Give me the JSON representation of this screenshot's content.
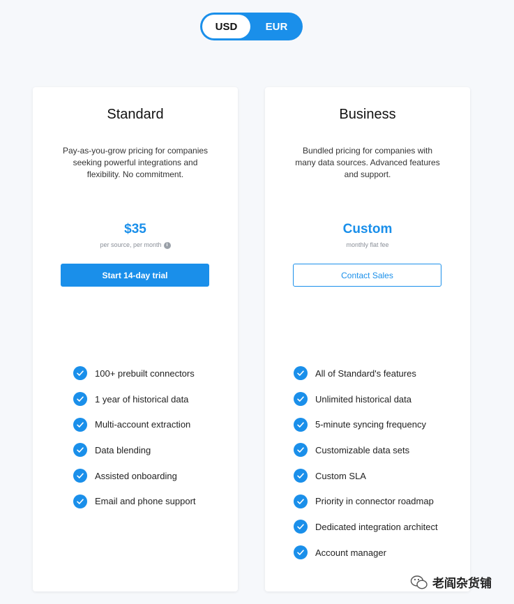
{
  "currency_toggle": {
    "options": [
      "USD",
      "EUR"
    ],
    "selected": "USD"
  },
  "plans": [
    {
      "title": "Standard",
      "description": "Pay-as-you-grow pricing for companies seeking powerful integrations and flexibility. No commitment.",
      "price": "$35",
      "price_note": "per source, per month",
      "cta": "Start 14-day trial",
      "features": [
        "100+ prebuilt connectors",
        "1 year of historical data",
        "Multi-account extraction",
        "Data blending",
        "Assisted onboarding",
        "Email and phone support"
      ]
    },
    {
      "title": "Business",
      "description": "Bundled pricing for companies with many data sources. Advanced features and support.",
      "price": "Custom",
      "price_note": "monthly flat fee",
      "cta": "Contact Sales",
      "features": [
        "All of Standard's features",
        "Unlimited historical data",
        "5-minute syncing frequency",
        "Customizable data sets",
        "Custom SLA",
        "Priority in connector roadmap",
        "Dedicated integration architect",
        "Account manager"
      ]
    }
  ],
  "watermark": {
    "text": "老阎杂货铺"
  },
  "colors": {
    "accent": "#1a8fea",
    "background": "#f6f8fb",
    "card": "#ffffff"
  },
  "icons": {
    "check": "check-circle-icon",
    "info": "info-icon",
    "watermark": "wechat-icon"
  }
}
